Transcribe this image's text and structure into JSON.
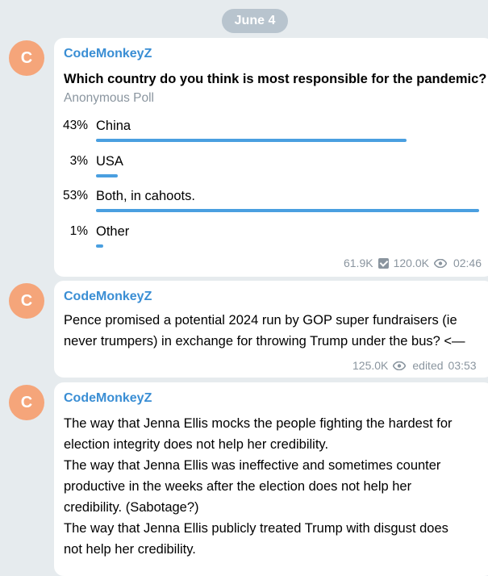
{
  "date_separator": "June 4",
  "messages": [
    {
      "avatar_letter": "C",
      "author": "CodeMonkeyZ",
      "poll": {
        "question": "Which country do you think is most responsible for the pandemic?",
        "type": "Anonymous Poll",
        "options": [
          {
            "percent_label": "43%",
            "label": "China",
            "fraction": 0.43
          },
          {
            "percent_label": "3%",
            "label": "USA",
            "fraction": 0.03
          },
          {
            "percent_label": "53%",
            "label": "Both, in cahoots.",
            "fraction": 0.53
          },
          {
            "percent_label": "1%",
            "label": "Other",
            "fraction": 0.01
          }
        ]
      },
      "voters": "61.9K",
      "views": "120.0K",
      "time": "02:46"
    },
    {
      "avatar_letter": "C",
      "author": "CodeMonkeyZ",
      "lines": [
        "Pence promised a potential 2024 run by GOP super fundraisers (ie",
        "never trumpers) in exchange for throwing Trump under the bus? <—"
      ],
      "views": "125.0K",
      "edited": "edited",
      "time": "03:53"
    },
    {
      "avatar_letter": "C",
      "author": "CodeMonkeyZ",
      "lines": [
        "The way that Jenna Ellis mocks the people fighting the hardest for",
        "election integrity does not help her credibility.",
        "The way that Jenna Ellis was ineffective and sometimes counter",
        "productive in the weeks after the election does not help her",
        "credibility. (Sabotage?)",
        "The way that Jenna Ellis publicly treated Trump with disgust does",
        "not help her credibility."
      ]
    }
  ]
}
